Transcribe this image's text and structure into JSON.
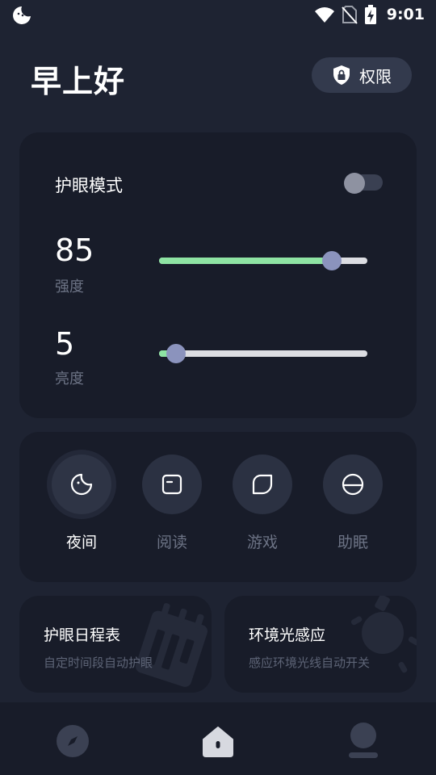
{
  "status_bar": {
    "time": "9:01"
  },
  "header": {
    "greeting": "早上好",
    "permission_label": "权限"
  },
  "eye_care": {
    "title": "护眼模式",
    "enabled": false,
    "intensity": {
      "value": "85",
      "label": "强度",
      "fraction": 0.83
    },
    "brightness": {
      "value": "5",
      "label": "亮度",
      "fraction": 0.08
    }
  },
  "modes": {
    "items": [
      {
        "label": "夜间",
        "icon": "moon-icon",
        "active": true
      },
      {
        "label": "阅读",
        "icon": "book-icon",
        "active": false
      },
      {
        "label": "游戏",
        "icon": "leaf-icon",
        "active": false
      },
      {
        "label": "助眠",
        "icon": "sleep-icon",
        "active": false
      }
    ]
  },
  "features": {
    "schedule": {
      "title": "护眼日程表",
      "subtitle": "自定时间段自动护眼"
    },
    "ambient": {
      "title": "环境光感应",
      "subtitle": "感应环境光线自动开关"
    }
  },
  "bottom_nav": {
    "items": [
      {
        "icon": "compass-icon",
        "active": false
      },
      {
        "icon": "home-icon",
        "active": true
      },
      {
        "icon": "profile-icon",
        "active": false
      }
    ]
  },
  "colors": {
    "background": "#1e2332",
    "card": "#181c29",
    "accent_green": "#8ee3a3",
    "slider_thumb": "#8b93bd"
  }
}
